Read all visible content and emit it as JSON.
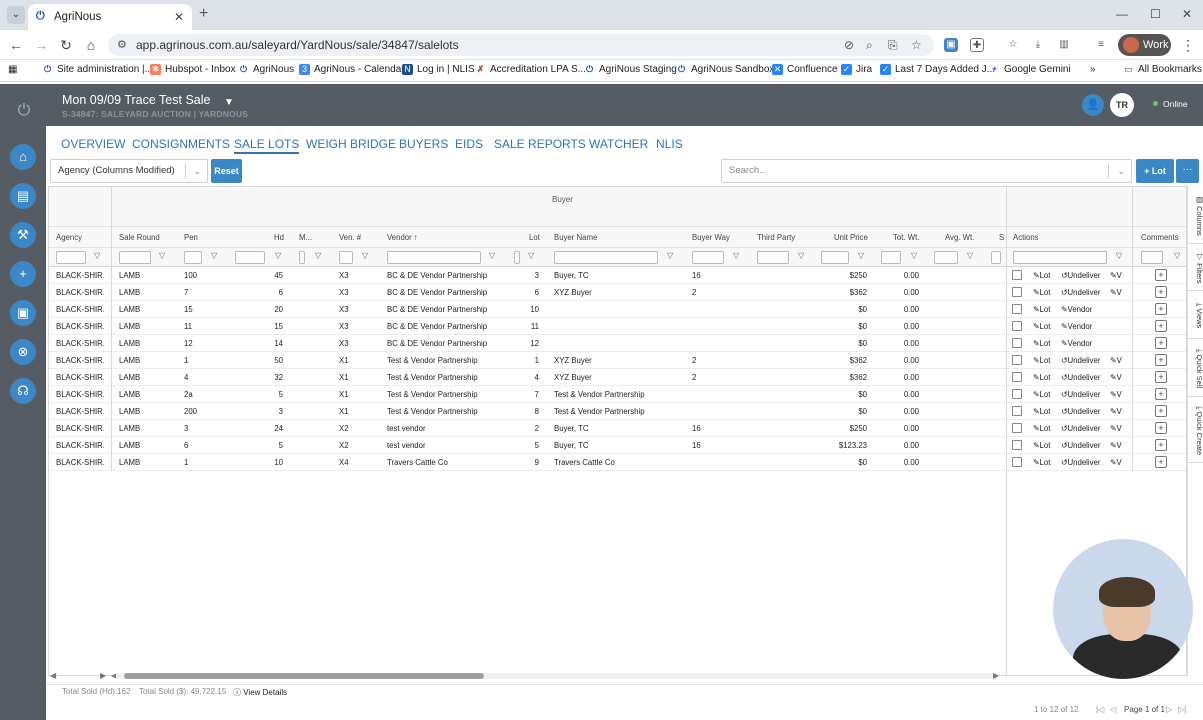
{
  "browser": {
    "tab_title": "AgriNous",
    "url": "app.agrinous.com.au/saleyard/YardNous/sale/34847/salelots",
    "profile_label": "Work",
    "bookmarks": [
      {
        "label": "Site administration |...",
        "icon": "agrinous-icon"
      },
      {
        "label": "Hubspot - Inbox",
        "icon": "hubspot-icon"
      },
      {
        "label": "AgriNous",
        "icon": "agrinous-icon"
      },
      {
        "label": "AgriNous - Calendar",
        "icon": "calendar-icon"
      },
      {
        "label": "Log in | NLIS",
        "icon": "nlis-icon"
      },
      {
        "label": "Accreditation LPA S...",
        "icon": "lpa-icon"
      },
      {
        "label": "AgriNous Staging",
        "icon": "agrinous-icon"
      },
      {
        "label": "AgriNous Sandbox",
        "icon": "agrinous-icon"
      },
      {
        "label": "Confluence",
        "icon": "confluence-icon"
      },
      {
        "label": "Jira",
        "icon": "jira-icon"
      },
      {
        "label": "Last 7 Days Added J...",
        "icon": "jira-icon"
      },
      {
        "label": "Google Gemini",
        "icon": "gemini-icon"
      }
    ],
    "all_bookmarks_label": "All Bookmarks"
  },
  "header": {
    "sale_title": "Mon 09/09 Trace Test Sale",
    "sale_subtitle": "S-34847: SALEYARD AUCTION | YARDNOUS",
    "avatar_initials": "TR",
    "status": "Online"
  },
  "nav": {
    "tabs": [
      "OVERVIEW",
      "CONSIGNMENTS",
      "SALE LOTS",
      "WEIGH BRIDGE",
      "BUYERS",
      "EIDS",
      "SALE REPORTS",
      "WATCHER",
      "NLIS"
    ],
    "active": "SALE LOTS"
  },
  "toolbar": {
    "view_select": "Agency (Columns Modified)",
    "reset_label": "Reset",
    "search_placeholder": "Search...",
    "add_lot_label": "+ Lot",
    "more_label": "···"
  },
  "grid": {
    "group_label": "Buyer",
    "columns": {
      "agency": "Agency",
      "sale_round": "Sale Round",
      "pen": "Pen",
      "hd": "Hd",
      "m": "M...",
      "ven": "Ven. #",
      "vendor": "Vendor",
      "lot": "Lot",
      "buyer_name": "Buyer Name",
      "buyer_way": "Buyer Way",
      "third_party": "Third Party",
      "unit_price": "Unit Price",
      "tot_wt": "Tot. Wt.",
      "avg_wt": "Avg. Wt.",
      "s": "S",
      "actions": "Actions",
      "comments": "Comments"
    },
    "rows": [
      {
        "agency": "BLACK-SHIR...",
        "round": "LAMB",
        "pen": "100",
        "hd": "45",
        "ven": "X3",
        "vendor": "BC & DE Vendor Partnership",
        "lot": "3",
        "buyer": "Buyer, TC",
        "way": "16",
        "price": "$250",
        "wt": "0.00",
        "actions": "full"
      },
      {
        "agency": "BLACK-SHIR...",
        "round": "LAMB",
        "pen": "7",
        "hd": "6",
        "ven": "X3",
        "vendor": "BC & DE Vendor Partnership",
        "lot": "6",
        "buyer": "XYZ Buyer",
        "way": "2",
        "price": "$362",
        "wt": "0.00",
        "actions": "full"
      },
      {
        "agency": "BLACK-SHIR...",
        "round": "LAMB",
        "pen": "15",
        "hd": "20",
        "ven": "X3",
        "vendor": "BC & DE Vendor Partnership",
        "lot": "10",
        "buyer": "",
        "way": "",
        "price": "$0",
        "wt": "0.00",
        "actions": "vendor"
      },
      {
        "agency": "BLACK-SHIR...",
        "round": "LAMB",
        "pen": "11",
        "hd": "15",
        "ven": "X3",
        "vendor": "BC & DE Vendor Partnership",
        "lot": "11",
        "buyer": "",
        "way": "",
        "price": "$0",
        "wt": "0.00",
        "actions": "vendor"
      },
      {
        "agency": "BLACK-SHIR...",
        "round": "LAMB",
        "pen": "12",
        "hd": "14",
        "ven": "X3",
        "vendor": "BC & DE Vendor Partnership",
        "lot": "12",
        "buyer": "",
        "way": "",
        "price": "$0",
        "wt": "0.00",
        "actions": "vendor"
      },
      {
        "agency": "BLACK-SHIR...",
        "round": "LAMB",
        "pen": "1",
        "hd": "50",
        "ven": "X1",
        "vendor": "Test & Vendor Partnership",
        "lot": "1",
        "buyer": "XYZ Buyer",
        "way": "2",
        "price": "$362",
        "wt": "0.00",
        "actions": "full"
      },
      {
        "agency": "BLACK-SHIR...",
        "round": "LAMB",
        "pen": "4",
        "hd": "32",
        "ven": "X1",
        "vendor": "Test & Vendor Partnership",
        "lot": "4",
        "buyer": "XYZ Buyer",
        "way": "2",
        "price": "$362",
        "wt": "0.00",
        "actions": "full"
      },
      {
        "agency": "BLACK-SHIR...",
        "round": "LAMB",
        "pen": "2a",
        "hd": "5",
        "ven": "X1",
        "vendor": "Test & Vendor Partnership",
        "lot": "7",
        "buyer": "Test & Vendor Partnership",
        "way": "",
        "price": "$0",
        "wt": "0.00",
        "actions": "full"
      },
      {
        "agency": "BLACK-SHIR...",
        "round": "LAMB",
        "pen": "200",
        "hd": "3",
        "ven": "X1",
        "vendor": "Test & Vendor Partnership",
        "lot": "8",
        "buyer": "Test & Vendor Partnership",
        "way": "",
        "price": "$0",
        "wt": "0.00",
        "actions": "full"
      },
      {
        "agency": "BLACK-SHIR...",
        "round": "LAMB",
        "pen": "3",
        "hd": "24",
        "ven": "X2",
        "vendor": "test vendor",
        "lot": "2",
        "buyer": "Buyer, TC",
        "way": "16",
        "price": "$250",
        "wt": "0.00",
        "actions": "full"
      },
      {
        "agency": "BLACK-SHIR...",
        "round": "LAMB",
        "pen": "6",
        "hd": "5",
        "ven": "X2",
        "vendor": "test vendor",
        "lot": "5",
        "buyer": "Buyer, TC",
        "way": "16",
        "price": "$123.23",
        "wt": "0.00",
        "actions": "full"
      },
      {
        "agency": "BLACK-SHIR...",
        "round": "LAMB",
        "pen": "1",
        "hd": "10",
        "ven": "X4",
        "vendor": "Travers Cattle Co",
        "lot": "9",
        "buyer": "Travers Cattle Co",
        "way": "",
        "price": "$0",
        "wt": "0.00",
        "actions": "full"
      }
    ],
    "action_labels": {
      "lot": "Lot",
      "undeliver": "Undeliver",
      "vendor": "Vendor",
      "v": "V"
    }
  },
  "side_tabs": [
    "Columns",
    "Filters",
    "Views",
    "Quick Sell",
    "Quick Create"
  ],
  "footer": {
    "total_sold_hd": "Total Sold (Hd):162",
    "total_sold_dollars": "Total Sold ($): 49,722.15",
    "view_details": "View Details",
    "range": "1 to 12 of 12",
    "page": "Page 1 of 1"
  }
}
